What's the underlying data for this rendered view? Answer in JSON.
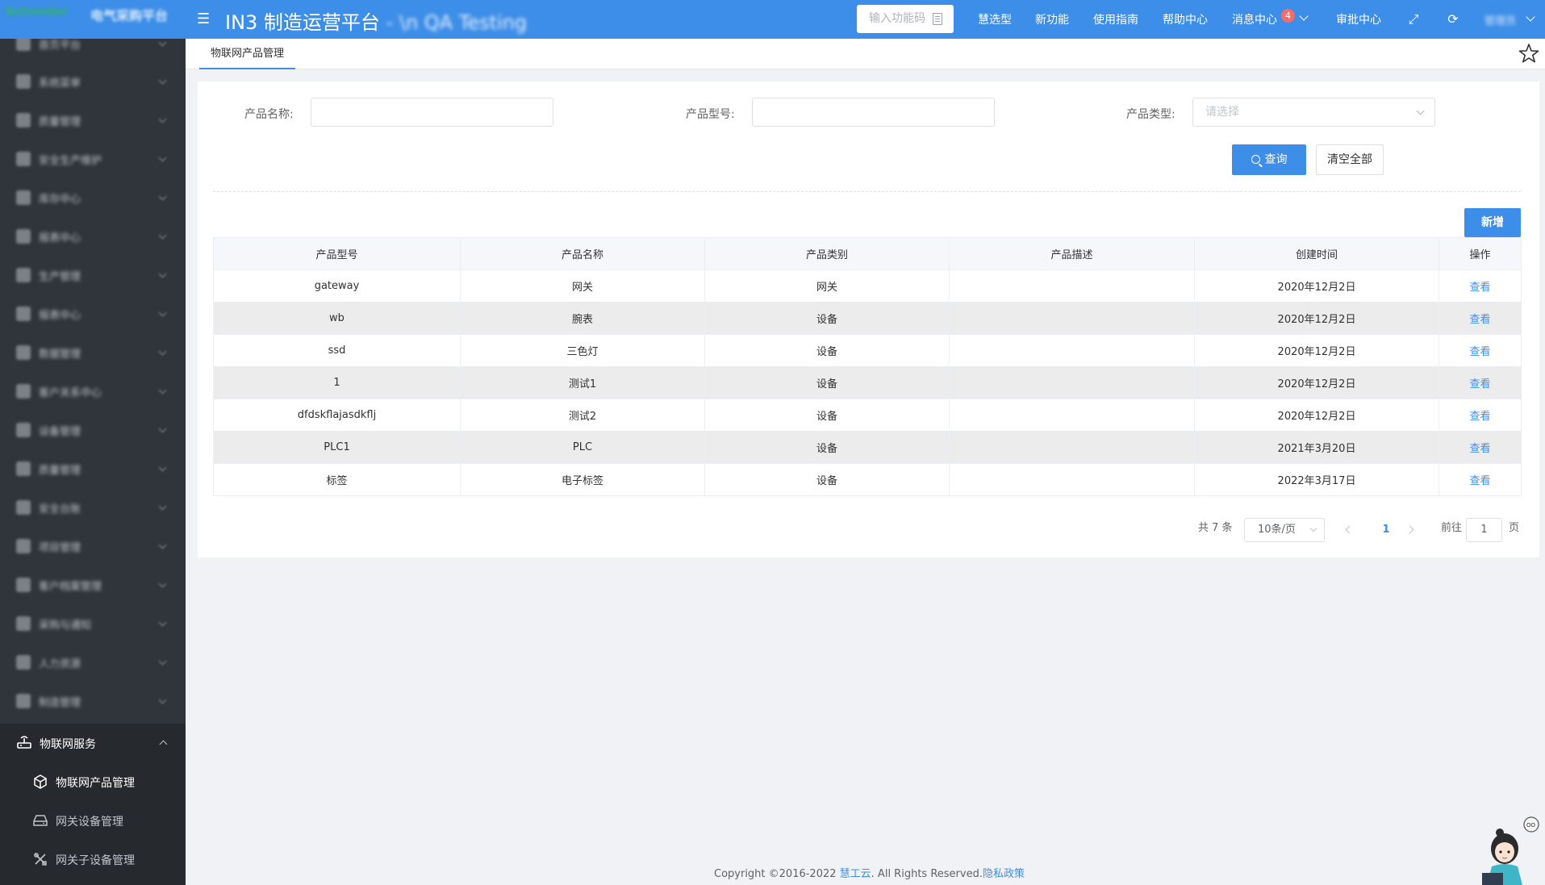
{
  "header": {
    "brand": "Schneider",
    "brand_sub": "电气采购平台",
    "title": "IN3 制造运营平台",
    "title_suffix": "- \\n QA Testing",
    "func_code_placeholder": "输入功能码",
    "nav": [
      "慧选型",
      "新功能",
      "使用指南",
      "帮助中心",
      "消息中心",
      "审批中心"
    ],
    "message_count": "4",
    "user": "管理员"
  },
  "sidebar": {
    "blurred_items": [
      "首页平台",
      "系统菜单",
      "质量管理",
      "安全生产维护",
      "库存中心",
      "报表中心",
      "生产管理",
      "报表中心",
      "数据管理",
      "客户关系中心",
      "设备管理",
      "质量管理",
      "安全台账",
      "项目管理",
      "客户档案管理",
      "采购与通知",
      "人力资源",
      "制造管理"
    ],
    "group_label": "物联网服务",
    "sub_items": [
      "物联网产品管理",
      "网关设备管理",
      "网关子设备管理"
    ]
  },
  "tabs": [
    "物联网产品管理"
  ],
  "filters": {
    "name_label": "产品名称:",
    "model_label": "产品型号:",
    "type_label": "产品类型:",
    "type_placeholder": "请选择",
    "query_button": "查询",
    "clear_button": "清空全部",
    "add_button": "新增"
  },
  "table": {
    "headers": [
      "产品型号",
      "产品名称",
      "产品类别",
      "产品描述",
      "创建时间",
      "操作"
    ],
    "rows": [
      [
        "gateway",
        "网关",
        "网关",
        "",
        "2020年12月2日",
        "查看"
      ],
      [
        "wb",
        "腕表",
        "设备",
        "",
        "2020年12月2日",
        "查看"
      ],
      [
        "ssd",
        "三色灯",
        "设备",
        "",
        "2020年12月2日",
        "查看"
      ],
      [
        "1",
        "测试1",
        "设备",
        "",
        "2020年12月2日",
        "查看"
      ],
      [
        "dfdskflajasdkflj",
        "测试2",
        "设备",
        "",
        "2020年12月2日",
        "查看"
      ],
      [
        "PLC1",
        "PLC",
        "设备",
        "",
        "2021年3月20日",
        "查看"
      ],
      [
        "标签",
        "电子标签",
        "设备",
        "",
        "2022年3月17日",
        "查看"
      ]
    ]
  },
  "pagination": {
    "total": "共 7 条",
    "page_size": "10条/页",
    "current": "1",
    "goto_prefix": "前往",
    "goto_value": "1",
    "goto_suffix": "页"
  },
  "footer": {
    "copyright": "Copyright ©2016-2022 ",
    "company": "慧工云",
    "rights": ". All Rights Reserved.",
    "privacy": "隐私政策"
  },
  "colors": {
    "primary": "#3d8ee8",
    "sidebar": "#30353b",
    "badge": "#f56c6c"
  }
}
